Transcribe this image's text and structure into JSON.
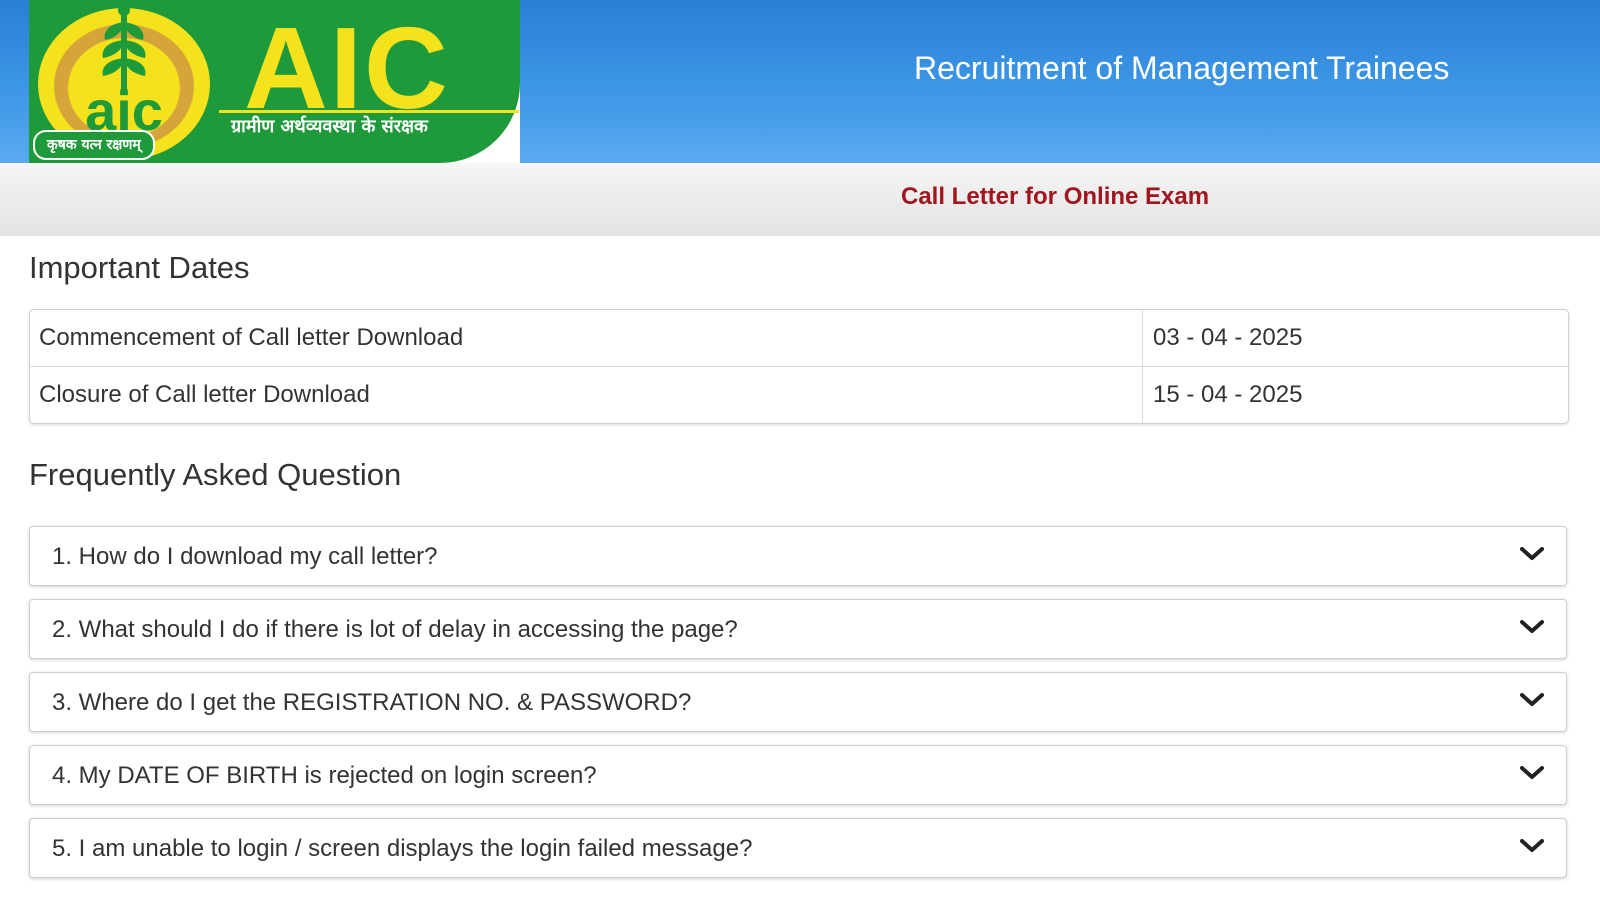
{
  "header": {
    "logo": {
      "brand": "AIC",
      "tagline_hindi": "ग्रामीण अर्थव्यवस्था के संरक्षक",
      "motto_hindi": "कृषक यत्न रक्षणम्",
      "emblem_text": "aic",
      "brand_color": "#1f9a3a",
      "brand_text_color": "#f3e21c"
    },
    "title": "Recruitment of Management Trainees",
    "bar_color": "#3d96e6"
  },
  "subheader": {
    "title": "Call Letter for Online Exam",
    "title_color": "#a0161e"
  },
  "important_dates": {
    "heading": "Important Dates",
    "rows": [
      {
        "label": "Commencement of Call letter Download",
        "value": "03 - 04 - 2025"
      },
      {
        "label": "Closure of Call letter Download",
        "value": "15 - 04 - 2025"
      }
    ]
  },
  "faq": {
    "heading": "Frequently Asked Question",
    "items": [
      {
        "question": "1. How do I download my call letter?",
        "icon": "chevron-down-icon"
      },
      {
        "question": "2. What should I do if there is lot of delay in accessing the page?",
        "icon": "chevron-down-icon"
      },
      {
        "question": "3. Where do I get the REGISTRATION NO. & PASSWORD?",
        "icon": "chevron-down-icon"
      },
      {
        "question": "4. My DATE OF BIRTH is rejected on login screen?",
        "icon": "chevron-down-icon"
      },
      {
        "question": "5. I am unable to login / screen displays the login failed message?",
        "icon": "chevron-down-icon"
      }
    ]
  }
}
